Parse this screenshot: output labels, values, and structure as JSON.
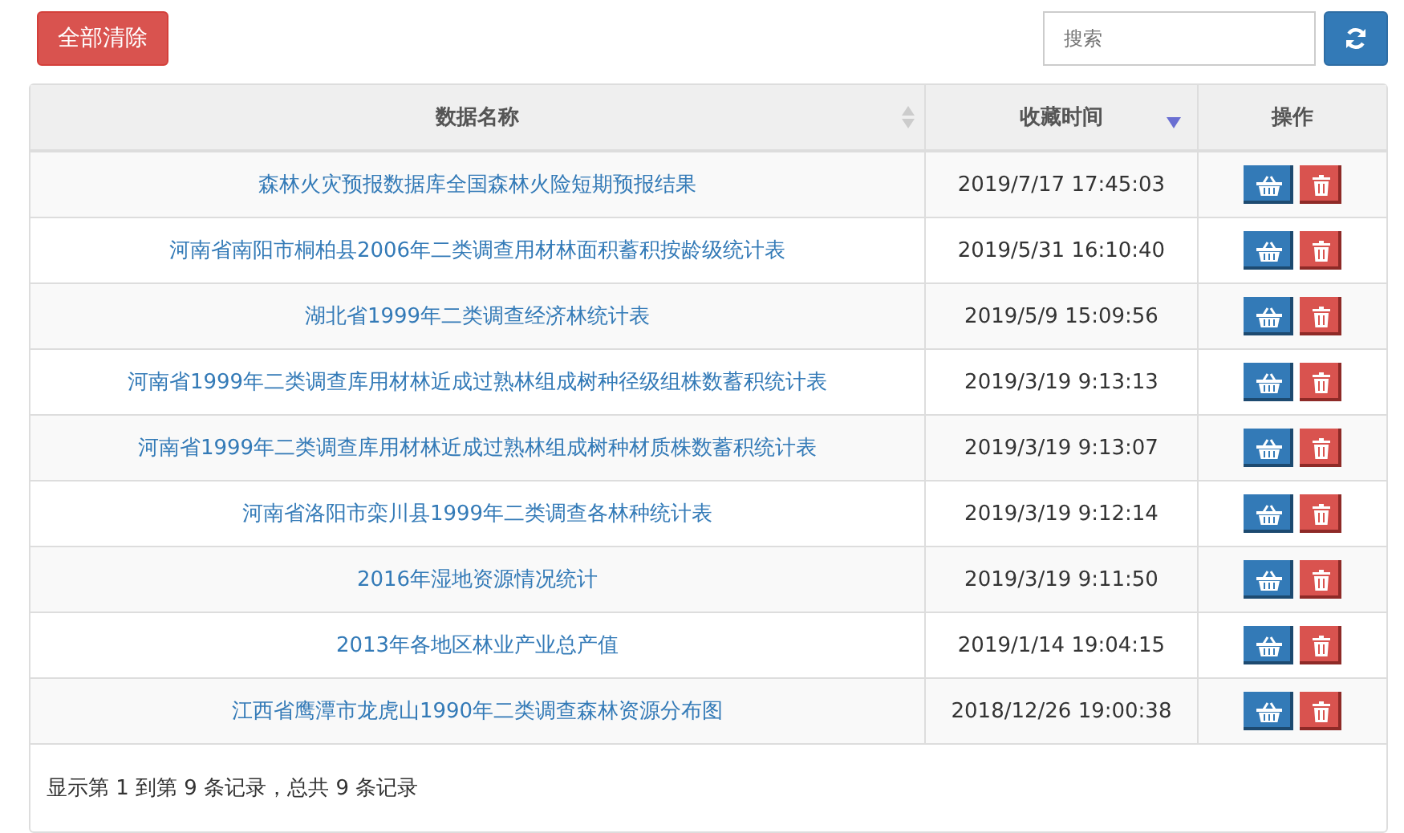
{
  "toolbar": {
    "clear_button": "全部清除",
    "search": {
      "placeholder": "搜索"
    }
  },
  "table": {
    "columns": [
      {
        "label": "数据名称",
        "sortable": true,
        "sorted_descending": false
      },
      {
        "label": "收藏时间",
        "sortable": true,
        "sorted_descending": true
      },
      {
        "label": "操作",
        "sortable": false,
        "sorted_descending": false
      }
    ],
    "rows": [
      {
        "name": "森林火灾预报数据库全国森林火险短期预报结果",
        "time": "2019/7/17 17:45:03"
      },
      {
        "name": "河南省南阳市桐柏县2006年二类调查用材林面积蓄积按龄级统计表",
        "time": "2019/5/31 16:10:40"
      },
      {
        "name": "湖北省1999年二类调查经济林统计表",
        "time": "2019/5/9 15:09:56"
      },
      {
        "name": "河南省1999年二类调查库用材林近成过熟林组成树种径级组株数蓄积统计表",
        "time": "2019/3/19 9:13:13"
      },
      {
        "name": "河南省1999年二类调查库用材林近成过熟林组成树种材质株数蓄积统计表",
        "time": "2019/3/19 9:13:07"
      },
      {
        "name": "河南省洛阳市栾川县1999年二类调查各林种统计表",
        "time": "2019/3/19 9:12:14"
      },
      {
        "name": "2016年湿地资源情况统计",
        "time": "2019/3/19 9:11:50"
      },
      {
        "name": "2013年各地区林业产业总产值",
        "time": "2019/1/14 19:04:15"
      },
      {
        "name": "江西省鹰潭市龙虎山1990年二类调查森林资源分布图",
        "time": "2018/12/26 19:00:38"
      }
    ]
  },
  "footer": "显示第 1 到第 9 条记录，总共 9 条记录"
}
